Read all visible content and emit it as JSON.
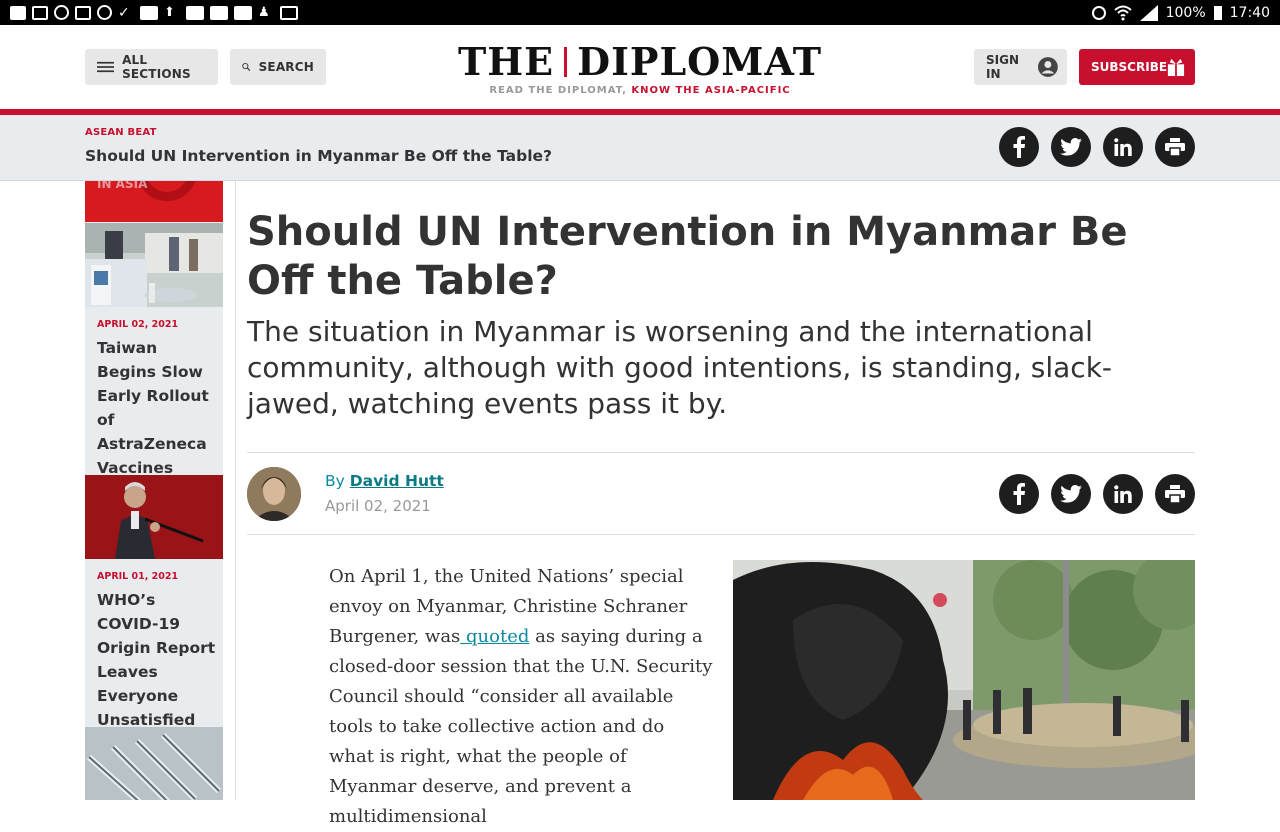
{
  "status_bar": {
    "battery": "100%",
    "time": "17:40"
  },
  "header": {
    "all_sections": "ALL SECTIONS",
    "search": "SEARCH",
    "logo_left": "THE",
    "logo_right": "DIPLOMAT",
    "tag_a": "READ THE DIPLOMAT,",
    "tag_b": "KNOW THE ASIA-PACIFIC",
    "sign_in": "SIGN IN",
    "subscribe": "SUBSCRIBE"
  },
  "sticky": {
    "kicker": "ASEAN BEAT",
    "title": "Should UN Intervention in Myanmar Be Off the Table?"
  },
  "sidebar": {
    "banner_text": "IN ASIA",
    "cards": [
      {
        "date": "APRIL 02, 2021",
        "title": "Taiwan Begins Slow Early Rollout of AstraZeneca Vaccines"
      },
      {
        "date": "APRIL 01, 2021",
        "title": "WHO’s COVID-19 Origin Report Leaves Everyone Unsatisfied"
      }
    ]
  },
  "article": {
    "title": "Should UN Intervention in Myanmar Be Off the Table?",
    "subtitle": "The situation in Myanmar is worsening and the international community, although with good intentions, is standing, slack-jawed, watching events pass it by.",
    "by": "By",
    "author": "David Hutt",
    "date": "April 02, 2021",
    "body_part1": "On April 1, the United Nations’ special envoy on Myanmar, Christine Schraner Burgener, was",
    "body_link": " quoted",
    "body_part2": " as saying during a closed-door session that the U.N. Security Council should “consider all available tools to take collective action and do what is right, what the people of Myanmar deserve, and prevent a multidimensional"
  },
  "icons": {
    "share": [
      "facebook-icon",
      "twitter-icon",
      "linkedin-icon",
      "print-icon"
    ]
  },
  "colors": {
    "brand_red": "#c8102e",
    "link_teal": "#0a8aa3",
    "share_bg": "#1e1e1e"
  }
}
